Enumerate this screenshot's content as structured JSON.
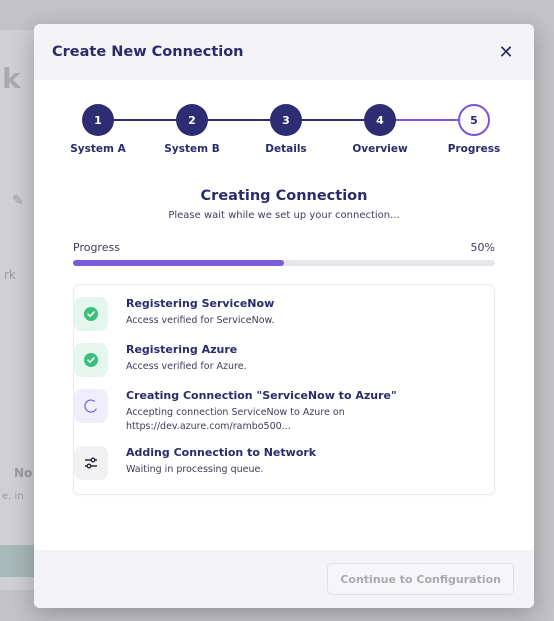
{
  "background": {
    "heading_fragment": "k",
    "fragment_1": "rk",
    "fragment_2": "No",
    "fragment_3": "e, in"
  },
  "modal": {
    "title": "Create New Connection",
    "close_glyph": "✕"
  },
  "stepper": {
    "current_step": 5,
    "steps": [
      {
        "number": "1",
        "label": "System A"
      },
      {
        "number": "2",
        "label": "System B"
      },
      {
        "number": "3",
        "label": "Details"
      },
      {
        "number": "4",
        "label": "Overview"
      },
      {
        "number": "5",
        "label": "Progress"
      }
    ]
  },
  "status": {
    "title": "Creating Connection",
    "subtitle": "Please wait while we set up your connection..."
  },
  "progress": {
    "label": "Progress",
    "percent_text": "50%",
    "value": 0.5
  },
  "tasks": [
    {
      "icon": "check-circle-icon",
      "state": "done",
      "title": "Registering ServiceNow",
      "desc": "Access verified for ServiceNow."
    },
    {
      "icon": "check-circle-icon",
      "state": "done",
      "title": "Registering Azure",
      "desc": "Access verified for Azure."
    },
    {
      "icon": "spinner-icon",
      "state": "pending",
      "title": "Creating Connection \"ServiceNow to Azure\"",
      "desc": "Accepting connection ServiceNow to Azure on https://dev.azure.com/rambo500..."
    },
    {
      "icon": "sliders-icon",
      "state": "queued",
      "title": "Adding Connection to Network",
      "desc": "Waiting in processing queue."
    }
  ],
  "footer": {
    "continue_label": "Continue to Configuration"
  },
  "colors": {
    "primary": "#2e2c72",
    "accent": "#7b5cdc",
    "success": "#3bbf7a"
  }
}
